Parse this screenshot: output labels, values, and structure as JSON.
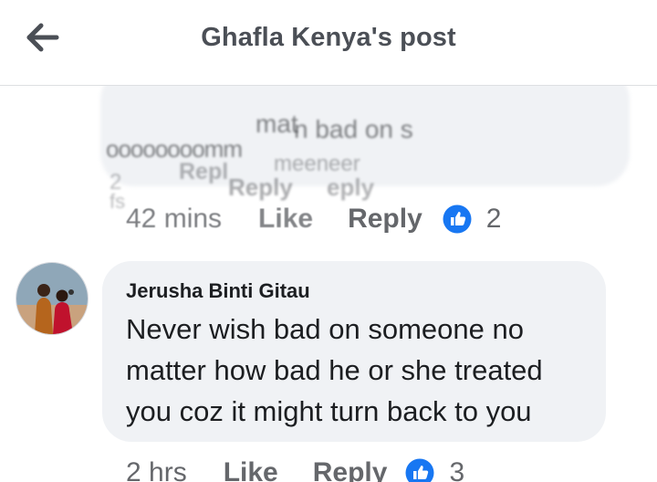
{
  "header": {
    "title": "Ghafla Kenya's post",
    "back_icon": "arrow-left-icon"
  },
  "previous_comment": {
    "ghost_text": [
      "mat",
      "n bad on s",
      "oooooooomm",
      "2",
      "Repl",
      "meeneer",
      "Reply",
      "eply",
      "fs"
    ],
    "time": "42 mins",
    "like_label": "Like",
    "reply_label": "Reply",
    "reaction_icon": "thumbs-up-icon",
    "reaction_count": "2"
  },
  "comment": {
    "avatar_icon": "user-avatar",
    "author": "Jerusha Binti Gitau",
    "lines": [
      "Never wish bad on someone no",
      "matter how bad he or she treated",
      "you coz it might turn back to you"
    ],
    "time": "2 hrs",
    "like_label": "Like",
    "reply_label": "Reply",
    "reaction_icon": "thumbs-up-icon",
    "reaction_count": "3"
  },
  "colors": {
    "bubble": "#f0f2f5",
    "meta_text": "#65676b",
    "primary_text": "#1c1e21",
    "header_text": "#4b4f56",
    "like_blue": "#1877f2"
  }
}
